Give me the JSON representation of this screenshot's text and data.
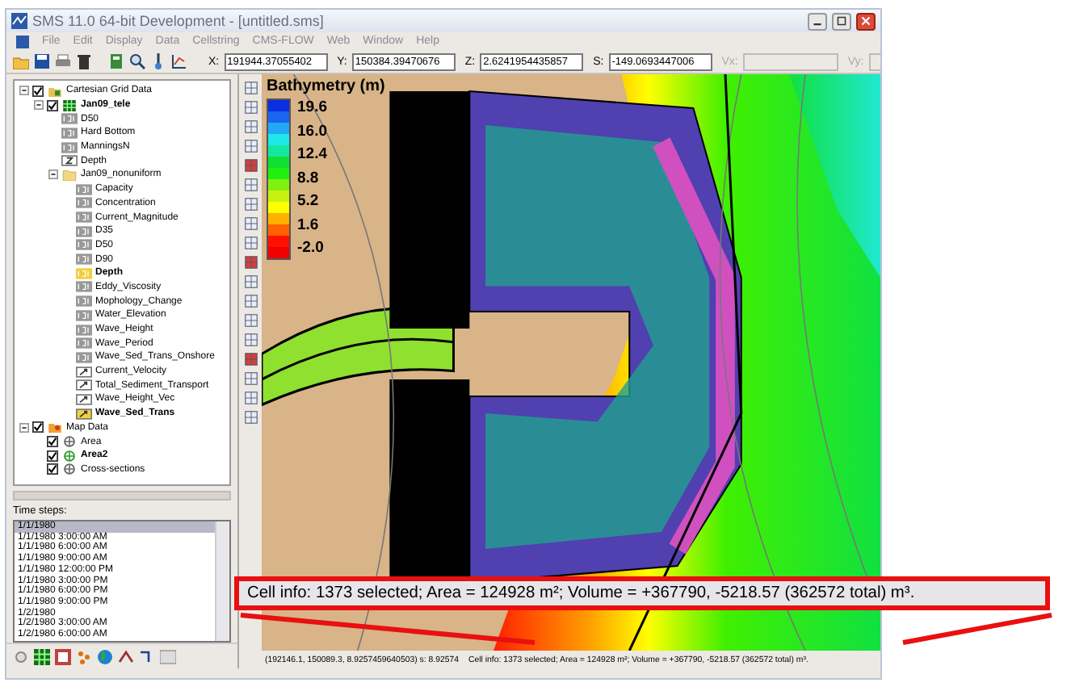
{
  "window": {
    "title": "SMS 11.0 64-bit Development - [untitled.sms]"
  },
  "menu": [
    "File",
    "Edit",
    "Display",
    "Data",
    "Cellstring",
    "CMS-FLOW",
    "Web",
    "Window",
    "Help"
  ],
  "coords": [
    {
      "label": "X:",
      "value": "191944.37055402"
    },
    {
      "label": "Y:",
      "value": "150384.39470676"
    },
    {
      "label": "Z:",
      "value": "2.6241954435857"
    },
    {
      "label": "S:",
      "value": "-149.0693447006"
    },
    {
      "label": "Vx:"
    },
    {
      "label": "Vy:"
    }
  ],
  "tree": [
    {
      "label": "Cartesian Grid Data",
      "kind": "folder",
      "checked": true,
      "active": false,
      "children": [
        {
          "label": "Jan09_tele",
          "kind": "grid",
          "checked": true,
          "active": true,
          "children": [
            {
              "label": "D50",
              "kind": "scalar",
              "active": false
            },
            {
              "label": "Hard Bottom",
              "kind": "scalar",
              "active": false
            },
            {
              "label": "ManningsN",
              "kind": "scalar",
              "active": false
            },
            {
              "label": "Depth",
              "kind": "zscalar",
              "active": false
            },
            {
              "label": "Jan09_nonuniform",
              "kind": "subfolder",
              "active": false,
              "children": [
                {
                  "label": "Capacity",
                  "kind": "scalar",
                  "active": false
                },
                {
                  "label": "Concentration",
                  "kind": "scalar",
                  "active": false
                },
                {
                  "label": "Current_Magnitude",
                  "kind": "scalar",
                  "active": false
                },
                {
                  "label": "D35",
                  "kind": "scalar",
                  "active": false
                },
                {
                  "label": "D50",
                  "kind": "scalar",
                  "active": false
                },
                {
                  "label": "D90",
                  "kind": "scalar",
                  "active": false
                },
                {
                  "label": "Depth",
                  "kind": "scalar",
                  "active": true
                },
                {
                  "label": "Eddy_Viscosity",
                  "kind": "scalar",
                  "active": false
                },
                {
                  "label": "Mophology_Change",
                  "kind": "scalar",
                  "active": false
                },
                {
                  "label": "Water_Elevation",
                  "kind": "scalar",
                  "active": false
                },
                {
                  "label": "Wave_Height",
                  "kind": "scalar",
                  "active": false
                },
                {
                  "label": "Wave_Period",
                  "kind": "scalar",
                  "active": false
                },
                {
                  "label": "Wave_Sed_Trans_Onshore",
                  "kind": "scalar",
                  "active": false
                },
                {
                  "label": "Current_Velocity",
                  "kind": "vector",
                  "active": false
                },
                {
                  "label": "Total_Sediment_Transport",
                  "kind": "vector",
                  "active": false
                },
                {
                  "label": "Wave_Height_Vec",
                  "kind": "vector",
                  "active": false
                },
                {
                  "label": "Wave_Sed_Trans",
                  "kind": "vector",
                  "active": true
                }
              ]
            }
          ]
        }
      ]
    },
    {
      "label": "Map Data",
      "kind": "map",
      "checked": true,
      "active": false,
      "children": [
        {
          "label": "Area",
          "kind": "coverage",
          "checked": true,
          "active": false
        },
        {
          "label": "Area2",
          "kind": "coverage",
          "checked": true,
          "active": true
        },
        {
          "label": "Cross-sections",
          "kind": "coverage",
          "checked": true,
          "active": false
        }
      ]
    }
  ],
  "time_steps": {
    "label": "Time steps:",
    "items": [
      {
        "label": "1/1/1980",
        "selected": true
      },
      {
        "label": "1/1/1980 3:00:00 AM",
        "selected": false
      },
      {
        "label": "1/1/1980 6:00:00 AM",
        "selected": false
      },
      {
        "label": "1/1/1980 9:00:00 AM",
        "selected": false
      },
      {
        "label": "1/1/1980 12:00:00 PM",
        "selected": false
      },
      {
        "label": "1/1/1980 3:00:00 PM",
        "selected": false
      },
      {
        "label": "1/1/1980 6:00:00 PM",
        "selected": false
      },
      {
        "label": "1/1/1980 9:00:00 PM",
        "selected": false
      },
      {
        "label": "1/2/1980",
        "selected": false
      },
      {
        "label": "1/2/1980 3:00:00 AM",
        "selected": false
      },
      {
        "label": "1/2/1980 6:00:00 AM",
        "selected": false
      }
    ]
  },
  "legend": {
    "title": "Bathymetry (m)",
    "labels": [
      "19.6",
      "16.0",
      "12.4",
      "8.8",
      "5.2",
      "1.6",
      "-2.0"
    ],
    "bands": [
      {
        "color": "#0a2ee0"
      },
      {
        "color": "#1a64f0"
      },
      {
        "color": "#22a8f4"
      },
      {
        "color": "#1ee8e8"
      },
      {
        "color": "#14e8a0"
      },
      {
        "color": "#10e030"
      },
      {
        "color": "#20f010"
      },
      {
        "color": "#80f010"
      },
      {
        "color": "#c8f010"
      },
      {
        "color": "#ffff00"
      },
      {
        "color": "#ffb000"
      },
      {
        "color": "#ff6000"
      },
      {
        "color": "#ff1000"
      },
      {
        "color": "#f00000"
      }
    ]
  },
  "status": {
    "position": "(192146.1, 150089.3, 8.9257459640503) s: 8.92574",
    "cell_info": "Cell info: 1373 selected; Area = 124928 m²; Volume = +367790, -5218.57 (362572 total) m³."
  },
  "callout": {
    "text": "Cell info: 1373 selected; Area = 124928 m²; Volume = +367790, -5218.57 (362572 total) m³."
  }
}
